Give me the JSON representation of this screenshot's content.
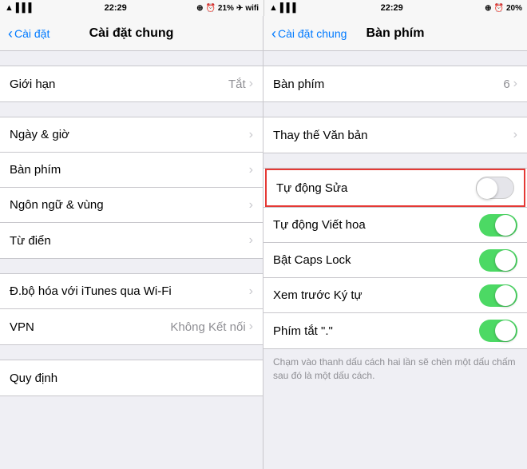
{
  "left_panel": {
    "status": {
      "time": "22:29",
      "signal_icon": "▌▌▌",
      "wifi_icon": "wifi",
      "battery_pct": "21%"
    },
    "nav": {
      "back_label": "Cài đặt",
      "title": "Cài đặt chung"
    },
    "groups": [
      {
        "id": "group1",
        "rows": [
          {
            "label": "Giới hạn",
            "value": "Tắt",
            "has_chevron": true
          }
        ]
      },
      {
        "id": "group2",
        "rows": [
          {
            "label": "Ngày & giờ",
            "value": "",
            "has_chevron": true
          },
          {
            "label": "Bàn phím",
            "value": "",
            "has_chevron": true
          },
          {
            "label": "Ngôn ngữ & vùng",
            "value": "",
            "has_chevron": true
          },
          {
            "label": "Từ điển",
            "value": "",
            "has_chevron": true
          }
        ]
      },
      {
        "id": "group3",
        "rows": [
          {
            "label": "Đ.bộ hóa với iTunes qua Wi-Fi",
            "value": "",
            "has_chevron": true
          },
          {
            "label": "VPN",
            "value": "Không Kết nối",
            "has_chevron": true
          }
        ]
      },
      {
        "id": "group4",
        "rows": [
          {
            "label": "Quy định",
            "value": "",
            "has_chevron": false
          }
        ]
      }
    ]
  },
  "right_panel": {
    "status": {
      "time": "22:29",
      "battery_pct": "20%"
    },
    "nav": {
      "back_label": "Cài đặt chung",
      "title": "Bàn phím"
    },
    "rows": [
      {
        "label": "Bàn phím",
        "value": "6",
        "has_chevron": true,
        "toggle": null,
        "highlight": false
      },
      {
        "label": "Thay thế Văn bản",
        "value": "",
        "has_chevron": true,
        "toggle": null,
        "highlight": false
      },
      {
        "label": "Tự động Sửa",
        "value": "",
        "has_chevron": false,
        "toggle": "off",
        "highlight": true
      },
      {
        "label": "Tự động Viết hoa",
        "value": "",
        "has_chevron": false,
        "toggle": "on",
        "highlight": false
      },
      {
        "label": "Bật Caps Lock",
        "value": "",
        "has_chevron": false,
        "toggle": "on",
        "highlight": false
      },
      {
        "label": "Xem trước Ký tự",
        "value": "",
        "has_chevron": false,
        "toggle": "on",
        "highlight": false
      },
      {
        "label": "Phím tắt \".\"",
        "value": "",
        "has_chevron": false,
        "toggle": "on",
        "highlight": false
      }
    ],
    "footnote": "Chạm vào thanh dấu cách hai lần sẽ chèn một dấu chấm sau đó là một dấu cách."
  }
}
